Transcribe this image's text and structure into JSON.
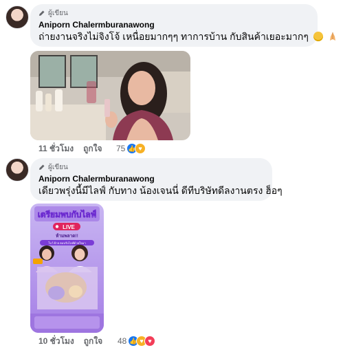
{
  "comments": [
    {
      "role": "ผู้เขียน",
      "author": "Aniporn Chalermburanawong",
      "text": "ถ่ายงานจริงไม่จิงโจ้ เหนื่อยมากๆๆ ทาการบ้าน กับสินค้าเยอะมากๆ",
      "emojis": [
        "pleading-face-emoji",
        "praying-hands-emoji"
      ],
      "age": "11 ชั่วโมง",
      "like_label": "ถูกใจ",
      "reaction_count": "75",
      "reactions": [
        "like",
        "care"
      ]
    },
    {
      "role": "ผู้เขียน",
      "author": "Aniporn Chalermburanawong",
      "text": "เดียวพรุ่งนี้มีไลฟ์ กับทาง น้องเจนนี่ ดีทีบริษัทดีลงานตรง ฮ็อๆ",
      "age": "10 ชั่วโมง",
      "like_label": "ถูกใจ",
      "reaction_count": "48",
      "reactions": [
        "like",
        "care",
        "love"
      ],
      "poster": {
        "headline": "เตรียมพบกับไลฟ์",
        "live_badge": "LIVE",
        "subline": "ห้ามพลาด!!",
        "banner": "โบว์ ฝ้าย ตอบรับไลฟ์ด้วยใจมา"
      }
    }
  ],
  "colors": {
    "like": "#1877f2",
    "care": "#f7b125",
    "love": "#f33e58",
    "meta": "#65676b",
    "bubble": "#f0f2f5"
  }
}
